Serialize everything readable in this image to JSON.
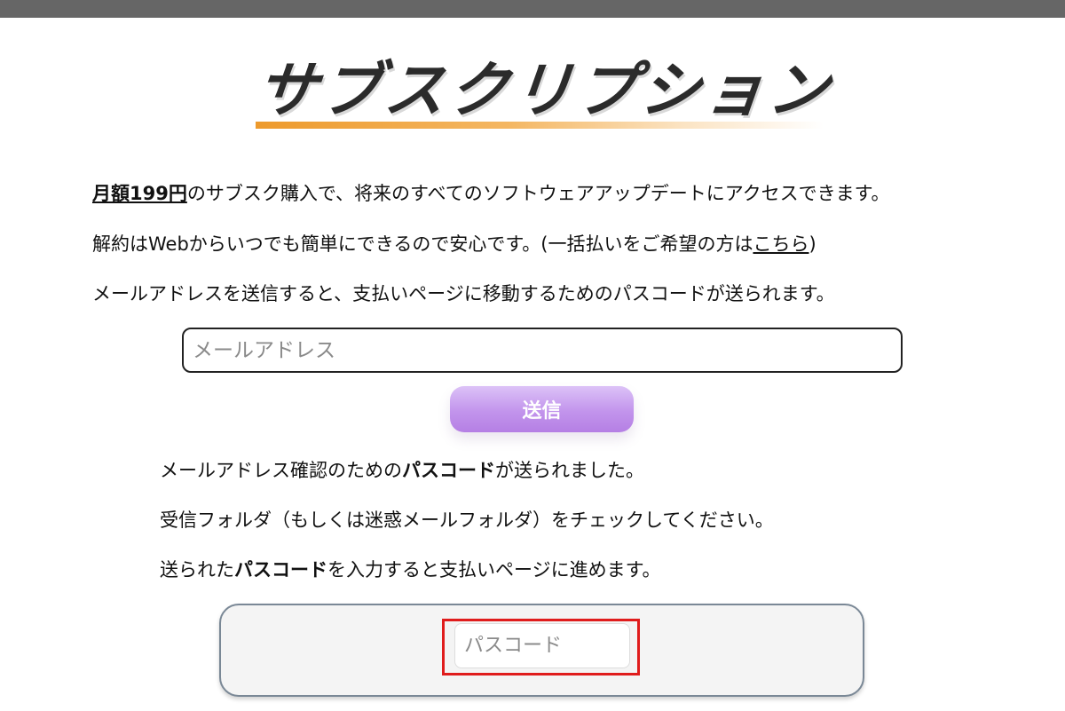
{
  "header": {
    "title": "サブスクリプション"
  },
  "intro": {
    "line1_strong": "月額199円",
    "line1_rest": "のサブスク購入で、将来のすべてのソフトウェアアップデートにアクセスできます。",
    "line2_prefix": "解約はWebからいつでも簡単にできるので安心です。(一括払いをご希望の方は",
    "line2_link": "こちら",
    "line2_suffix": ")",
    "line3": "メールアドレスを送信すると、支払いページに移動するためのパスコードが送られます。"
  },
  "email_form": {
    "placeholder": "メールアドレス",
    "submit_label": "送信"
  },
  "confirmation": {
    "line1_prefix": "メールアドレス確認のための",
    "line1_bold": "パスコード",
    "line1_suffix": "が送られました。",
    "line2": "受信フォルダ（もしくは迷惑メールフォルダ）をチェックしてください。",
    "line3_prefix": "送られた",
    "line3_bold": "パスコード",
    "line3_suffix": "を入力すると支払いページに進めます。"
  },
  "passcode_form": {
    "placeholder": "パスコード"
  },
  "colors": {
    "top_bar": "#666666",
    "title_underline": "#ed9a2c",
    "submit_button": "#c294ec",
    "highlight_border": "#e01c1c"
  }
}
